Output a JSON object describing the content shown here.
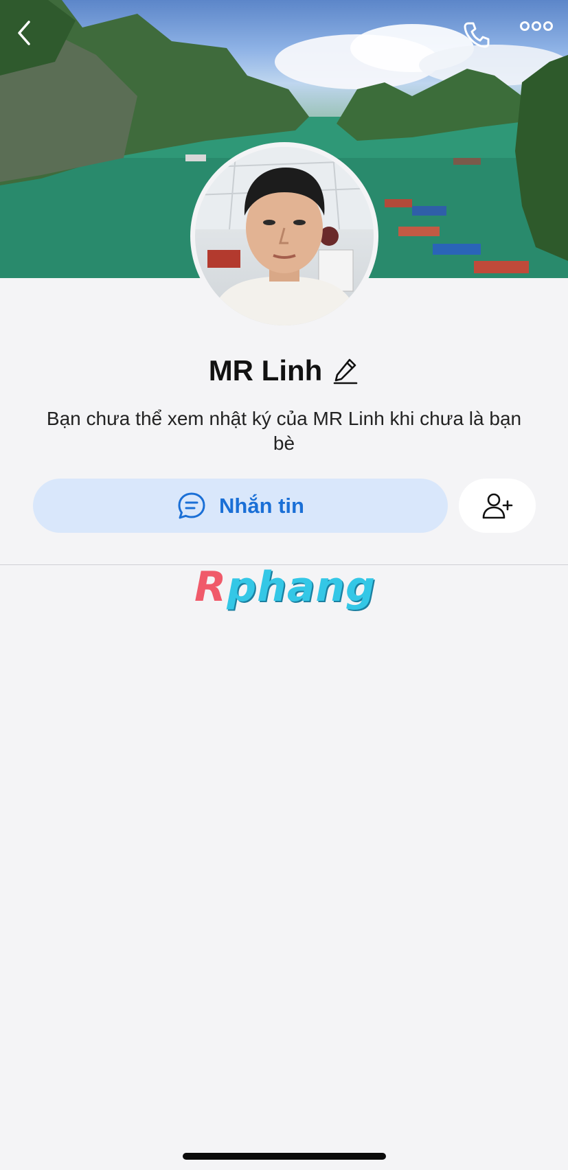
{
  "header": {
    "back_icon": "chevron-left-icon",
    "call_icon": "phone-icon",
    "more_icon": "more-horizontal-icon"
  },
  "profile": {
    "name": "MR Linh",
    "edit_icon": "pencil-icon",
    "notice": "Bạn chưa thể xem nhật ký của MR Linh khi chưa là bạn bè"
  },
  "actions": {
    "message_label": "Nhắn tin",
    "message_icon": "chat-bubble-icon",
    "add_friend_icon": "add-friend-icon"
  },
  "watermark": {
    "first": "R",
    "rest": "phang"
  },
  "colors": {
    "accent": "#1a6fd6",
    "message_button_bg": "#d9e7fb",
    "background": "#f4f4f6"
  }
}
